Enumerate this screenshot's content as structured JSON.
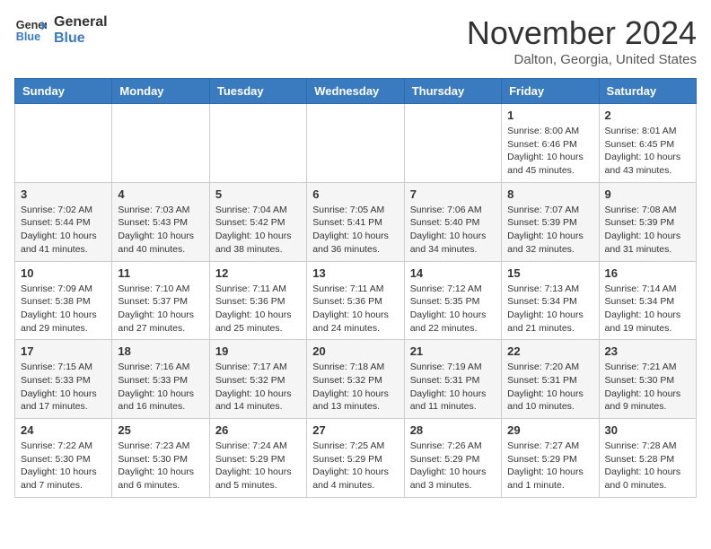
{
  "header": {
    "logo_line1": "General",
    "logo_line2": "Blue",
    "month": "November 2024",
    "location": "Dalton, Georgia, United States"
  },
  "weekdays": [
    "Sunday",
    "Monday",
    "Tuesday",
    "Wednesday",
    "Thursday",
    "Friday",
    "Saturday"
  ],
  "weeks": [
    [
      {
        "day": "",
        "info": ""
      },
      {
        "day": "",
        "info": ""
      },
      {
        "day": "",
        "info": ""
      },
      {
        "day": "",
        "info": ""
      },
      {
        "day": "",
        "info": ""
      },
      {
        "day": "1",
        "info": "Sunrise: 8:00 AM\nSunset: 6:46 PM\nDaylight: 10 hours\nand 45 minutes."
      },
      {
        "day": "2",
        "info": "Sunrise: 8:01 AM\nSunset: 6:45 PM\nDaylight: 10 hours\nand 43 minutes."
      }
    ],
    [
      {
        "day": "3",
        "info": "Sunrise: 7:02 AM\nSunset: 5:44 PM\nDaylight: 10 hours\nand 41 minutes."
      },
      {
        "day": "4",
        "info": "Sunrise: 7:03 AM\nSunset: 5:43 PM\nDaylight: 10 hours\nand 40 minutes."
      },
      {
        "day": "5",
        "info": "Sunrise: 7:04 AM\nSunset: 5:42 PM\nDaylight: 10 hours\nand 38 minutes."
      },
      {
        "day": "6",
        "info": "Sunrise: 7:05 AM\nSunset: 5:41 PM\nDaylight: 10 hours\nand 36 minutes."
      },
      {
        "day": "7",
        "info": "Sunrise: 7:06 AM\nSunset: 5:40 PM\nDaylight: 10 hours\nand 34 minutes."
      },
      {
        "day": "8",
        "info": "Sunrise: 7:07 AM\nSunset: 5:39 PM\nDaylight: 10 hours\nand 32 minutes."
      },
      {
        "day": "9",
        "info": "Sunrise: 7:08 AM\nSunset: 5:39 PM\nDaylight: 10 hours\nand 31 minutes."
      }
    ],
    [
      {
        "day": "10",
        "info": "Sunrise: 7:09 AM\nSunset: 5:38 PM\nDaylight: 10 hours\nand 29 minutes."
      },
      {
        "day": "11",
        "info": "Sunrise: 7:10 AM\nSunset: 5:37 PM\nDaylight: 10 hours\nand 27 minutes."
      },
      {
        "day": "12",
        "info": "Sunrise: 7:11 AM\nSunset: 5:36 PM\nDaylight: 10 hours\nand 25 minutes."
      },
      {
        "day": "13",
        "info": "Sunrise: 7:11 AM\nSunset: 5:36 PM\nDaylight: 10 hours\nand 24 minutes."
      },
      {
        "day": "14",
        "info": "Sunrise: 7:12 AM\nSunset: 5:35 PM\nDaylight: 10 hours\nand 22 minutes."
      },
      {
        "day": "15",
        "info": "Sunrise: 7:13 AM\nSunset: 5:34 PM\nDaylight: 10 hours\nand 21 minutes."
      },
      {
        "day": "16",
        "info": "Sunrise: 7:14 AM\nSunset: 5:34 PM\nDaylight: 10 hours\nand 19 minutes."
      }
    ],
    [
      {
        "day": "17",
        "info": "Sunrise: 7:15 AM\nSunset: 5:33 PM\nDaylight: 10 hours\nand 17 minutes."
      },
      {
        "day": "18",
        "info": "Sunrise: 7:16 AM\nSunset: 5:33 PM\nDaylight: 10 hours\nand 16 minutes."
      },
      {
        "day": "19",
        "info": "Sunrise: 7:17 AM\nSunset: 5:32 PM\nDaylight: 10 hours\nand 14 minutes."
      },
      {
        "day": "20",
        "info": "Sunrise: 7:18 AM\nSunset: 5:32 PM\nDaylight: 10 hours\nand 13 minutes."
      },
      {
        "day": "21",
        "info": "Sunrise: 7:19 AM\nSunset: 5:31 PM\nDaylight: 10 hours\nand 11 minutes."
      },
      {
        "day": "22",
        "info": "Sunrise: 7:20 AM\nSunset: 5:31 PM\nDaylight: 10 hours\nand 10 minutes."
      },
      {
        "day": "23",
        "info": "Sunrise: 7:21 AM\nSunset: 5:30 PM\nDaylight: 10 hours\nand 9 minutes."
      }
    ],
    [
      {
        "day": "24",
        "info": "Sunrise: 7:22 AM\nSunset: 5:30 PM\nDaylight: 10 hours\nand 7 minutes."
      },
      {
        "day": "25",
        "info": "Sunrise: 7:23 AM\nSunset: 5:30 PM\nDaylight: 10 hours\nand 6 minutes."
      },
      {
        "day": "26",
        "info": "Sunrise: 7:24 AM\nSunset: 5:29 PM\nDaylight: 10 hours\nand 5 minutes."
      },
      {
        "day": "27",
        "info": "Sunrise: 7:25 AM\nSunset: 5:29 PM\nDaylight: 10 hours\nand 4 minutes."
      },
      {
        "day": "28",
        "info": "Sunrise: 7:26 AM\nSunset: 5:29 PM\nDaylight: 10 hours\nand 3 minutes."
      },
      {
        "day": "29",
        "info": "Sunrise: 7:27 AM\nSunset: 5:29 PM\nDaylight: 10 hours\nand 1 minute."
      },
      {
        "day": "30",
        "info": "Sunrise: 7:28 AM\nSunset: 5:28 PM\nDaylight: 10 hours\nand 0 minutes."
      }
    ]
  ]
}
